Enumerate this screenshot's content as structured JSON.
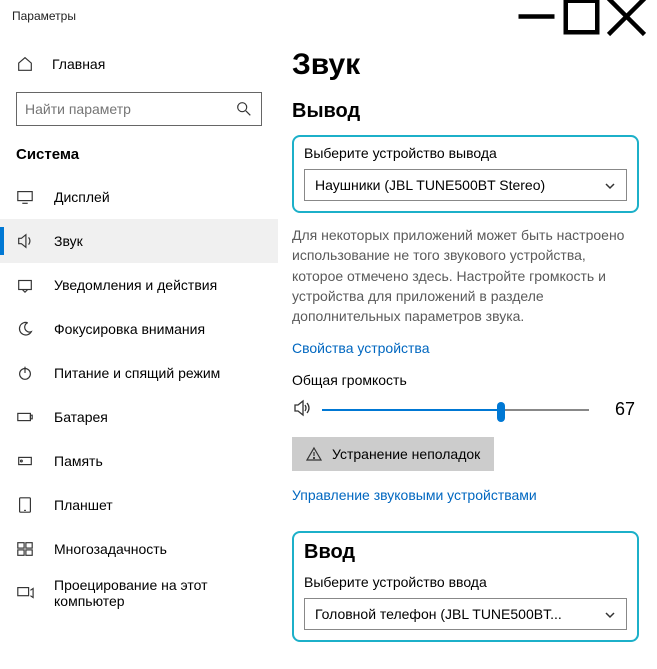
{
  "window": {
    "title": "Параметры"
  },
  "sidebar": {
    "home": "Главная",
    "search_placeholder": "Найти параметр",
    "section": "Система",
    "items": [
      {
        "label": "Дисплей"
      },
      {
        "label": "Звук"
      },
      {
        "label": "Уведомления и действия"
      },
      {
        "label": "Фокусировка внимания"
      },
      {
        "label": "Питание и спящий режим"
      },
      {
        "label": "Батарея"
      },
      {
        "label": "Память"
      },
      {
        "label": "Планшет"
      },
      {
        "label": "Многозадачность"
      },
      {
        "label": "Проецирование на этот компьютер"
      }
    ]
  },
  "main": {
    "title": "Звук",
    "output": {
      "heading": "Вывод",
      "field_label": "Выберите устройство вывода",
      "selected": "Наушники (JBL TUNE500BT Stereo)",
      "description": "Для некоторых приложений может быть настроено использование не того звукового устройства, которое отмечено здесь. Настройте громкость и устройства для приложений в разделе дополнительных параметров звука.",
      "props_link": "Свойства устройства",
      "volume_label": "Общая громкость",
      "volume_value": "67",
      "troubleshoot": "Устранение неполадок",
      "manage_link": "Управление звуковыми устройствами"
    },
    "input": {
      "heading": "Ввод",
      "field_label": "Выберите устройство ввода",
      "selected": "Головной телефон (JBL TUNE500BT..."
    }
  }
}
